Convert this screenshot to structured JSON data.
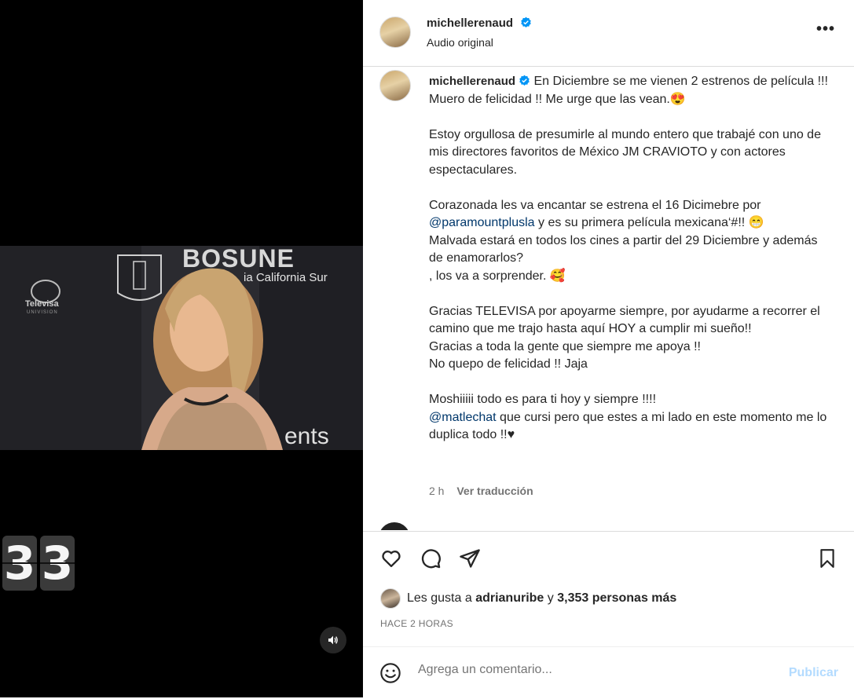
{
  "video": {
    "backdrop_brand": "BOSUNE",
    "backdrop_region": "ia California Sur",
    "backdrop_logo": "Televisa",
    "backdrop_logo_sub": "UNIVISION",
    "backdrop_ents": "ents",
    "counter_digits": [
      "3",
      "3"
    ],
    "volume_icon": "volume-icon"
  },
  "header": {
    "username": "michellerenaud",
    "subtitle": "Audio original",
    "more_label": "•••"
  },
  "caption": {
    "username": "michellerenaud",
    "paragraphs": [
      [
        "En Diciembre se me vienen 2 estrenos de película !!!",
        "Muero de felicidad !! Me urge que las vean.😍"
      ],
      [
        "Estoy orgullosa de presumirle al mundo entero que trabajé con uno de mis directores favoritos de México JM CRAVIOTO y con actores espectaculares."
      ],
      [
        "Corazonada les va encantar se estrena el 16 Dicimebre por"
      ],
      [
        "Gracias TELEVISA por apoyarme siempre, por ayudarme a recorrer el camino que me trajo hasta aquí HOY a cumplir mi sueño!!",
        "Gracias a toda la gente que siempre me apoya !!",
        "No quepo de felicidad !! Jaja"
      ],
      [
        "Moshiiiii todo es para ti hoy y siempre !!!!"
      ]
    ],
    "p3_mention": "@paramountplusla",
    "p3_after": " y es su primera película mexicana‘#!! 😁",
    "p3_line3": "Malvada estará en todos los cines a partir del 29 Diciembre y además de enamorarlos?",
    "p3_line4": ", los va a sorprender. 🥰",
    "p5_mention": "@matlechat",
    "p5_after": " que cursi pero que estes a mi lado en este momento me lo duplica todo !!♥",
    "time": "2 h",
    "translate": "Ver traducción"
  },
  "actions": {
    "like_icon": "heart-icon",
    "comment_icon": "comment-icon",
    "share_icon": "share-icon",
    "save_icon": "bookmark-icon"
  },
  "likes": {
    "prefix": "Les gusta a ",
    "user": "adrianuribe",
    "middle": " y ",
    "count": "3,353 personas más"
  },
  "timestamp": "HACE 2 HORAS",
  "comment": {
    "placeholder": "Agrega un comentario...",
    "publish": "Publicar",
    "emoji_icon": "emoji-icon"
  },
  "colors": {
    "verified": "#0095f6",
    "publish_disabled": "#b3dbff",
    "mention": "#00376b"
  }
}
